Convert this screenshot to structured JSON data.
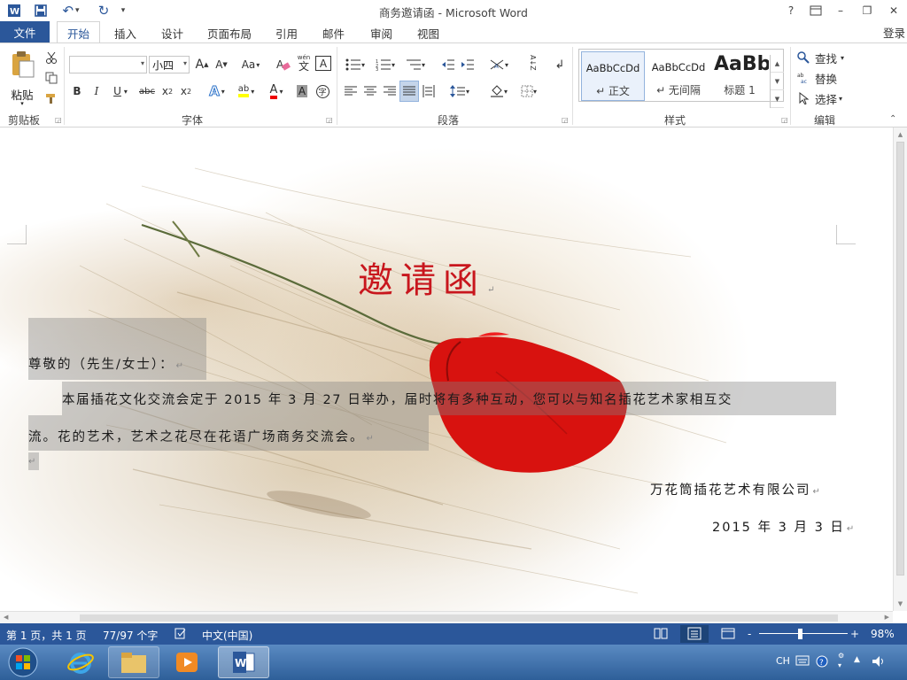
{
  "window": {
    "title": "商务邀请函 - Microsoft Word",
    "help": "?",
    "ribbon_options_icon": "ribbon-display-options-icon",
    "minimize": "–",
    "restore": "❐",
    "close": "✕"
  },
  "quick_access": {
    "undo_arrow": "↶",
    "redo_arrow": "↻",
    "dropdown": "▾"
  },
  "tabs": {
    "file": "文件",
    "items": [
      "开始",
      "插入",
      "设计",
      "页面布局",
      "引用",
      "邮件",
      "审阅",
      "视图"
    ],
    "login": "登录"
  },
  "ribbon": {
    "clipboard": {
      "label": "剪贴板",
      "paste": "粘贴"
    },
    "font": {
      "label": "字体",
      "font_name": "",
      "font_size": "小四",
      "grow": "A",
      "shrink": "A",
      "case": "Aa",
      "phonetic_top": "wén",
      "phonetic_char": "文",
      "border_char": "A",
      "bold": "B",
      "italic": "I",
      "underline": "U",
      "strike": "abc",
      "sub": "x",
      "sub_mark": "2",
      "sup": "x",
      "sup_mark": "2",
      "effects": "A",
      "highlight": "ab",
      "color": "A",
      "shading": "A",
      "enclose": "字"
    },
    "paragraph": {
      "label": "段落",
      "sort": "A↓Z"
    },
    "styles": {
      "label": "样式",
      "items": [
        {
          "sample": "AaBbCcDd",
          "name": "↵ 正文"
        },
        {
          "sample": "AaBbCcDd",
          "name": "↵ 无间隔"
        },
        {
          "sample": "AaBb",
          "name": "标题 1"
        }
      ]
    },
    "editing": {
      "label": "编辑",
      "find": "查找",
      "replace": "替换",
      "select": "选择"
    }
  },
  "document": {
    "title": "邀请函",
    "salutation": "尊敬的（先生/女士）：",
    "body_line1": "本届插花文化交流会定于 2015 年 3 月 27 日举办，届时将有多种互动，您可以与知名插花艺术家相互交",
    "body_line2": "流。花的艺术，艺术之花尽在花语广场商务交流会。",
    "company": "万花筒插花艺术有限公司",
    "date": "2015 年 3 月 3 日",
    "paragraph_mark": "↵"
  },
  "status": {
    "page": "第 1 页，共 1 页",
    "words": "77/97 个字",
    "language": "中文(中国)",
    "zoom_minus": "-",
    "zoom_plus": "+",
    "zoom": "98%",
    "zoom_fraction": 0.98
  },
  "taskbar": {
    "ime": "CH"
  },
  "colors": {
    "accent": "#2b579a",
    "title_red": "#c8161d",
    "status_bar": "#2b579a"
  }
}
